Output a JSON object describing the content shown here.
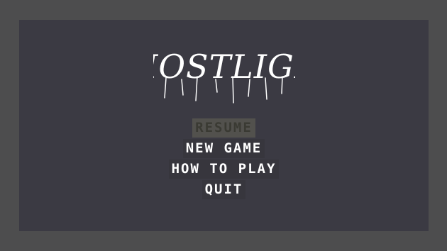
{
  "game": {
    "title": "GHOSTLIGHT"
  },
  "menu": {
    "items": [
      {
        "label": "RESUME",
        "enabled": false
      },
      {
        "label": "NEW GAME",
        "enabled": true
      },
      {
        "label": "HOW TO PLAY",
        "enabled": true
      },
      {
        "label": "QUIT",
        "enabled": true
      }
    ]
  },
  "colors": {
    "frame": "#4d4d4e",
    "screen": "#3b3a43",
    "text": "#ffffff",
    "disabled_text": "#3a3a33",
    "disabled_bg": "#52514d"
  }
}
